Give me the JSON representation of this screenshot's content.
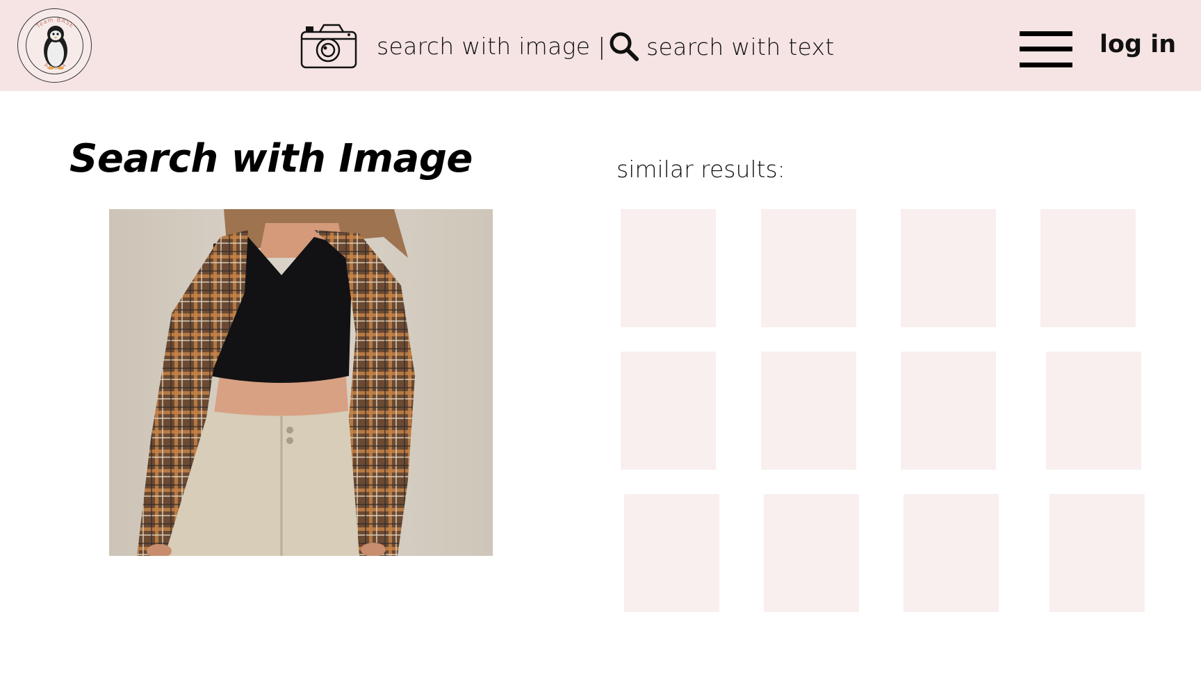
{
  "app": {
    "logo_text_top": "Team BASE",
    "logo_text_bottom": "AT CSA"
  },
  "header": {
    "nav_image_label": "search with image |",
    "nav_text_label": "search with text",
    "login_label": "log in",
    "icons": {
      "camera": "camera-icon",
      "search": "search-icon",
      "menu": "hamburger-menu-icon"
    }
  },
  "main": {
    "title": "Search with Image",
    "query_image_alt": "uploaded outfit photo",
    "results_label": "similar results:",
    "result_count": 12
  },
  "colors": {
    "header_bg": "#f5e4e3",
    "tile_bg": "#f8efee",
    "page_bg": "#ffffff"
  }
}
